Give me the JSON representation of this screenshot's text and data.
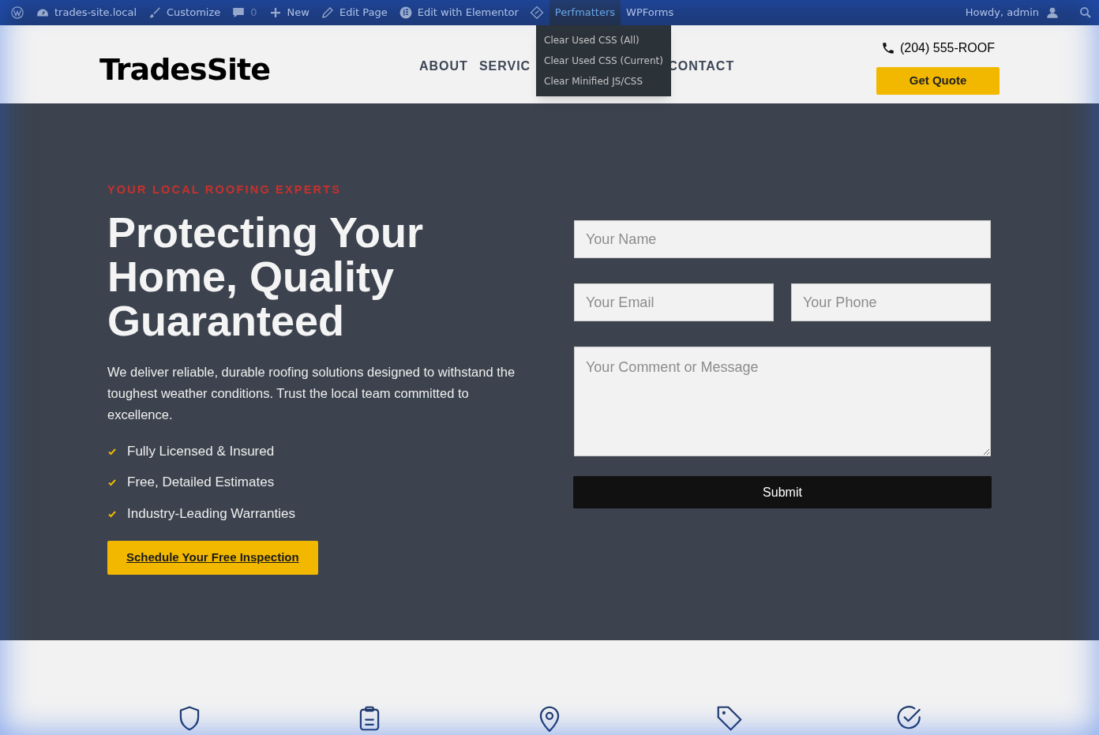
{
  "admin_bar": {
    "items": [
      {
        "kind": "wp"
      },
      {
        "kind": "site",
        "label": "trades-site.local"
      },
      {
        "kind": "brush",
        "label": "Customize"
      },
      {
        "kind": "comment",
        "label": "0"
      },
      {
        "kind": "plus",
        "label": "New"
      },
      {
        "kind": "pencil",
        "label": "Edit Page"
      },
      {
        "kind": "elementor",
        "label": "Edit with Elementor"
      },
      {
        "kind": "diamond"
      },
      {
        "kind": "text",
        "label": "Perfmatters",
        "selected": true
      },
      {
        "kind": "text",
        "label": "WPForms",
        "selected": false
      }
    ],
    "greeting": "Howdy, admin",
    "dropdown": [
      "Clear Used CSS (All)",
      "Clear Used CSS (Current)",
      "Clear Minified JS/CSS"
    ]
  },
  "header": {
    "logo": "TradesSite",
    "nav": [
      "ABOUT",
      "SERVIC",
      "CONTACT"
    ],
    "phone": "(204) 555-ROOF",
    "cta": "Get Quote"
  },
  "hero": {
    "eyebrow": "YOUR LOCAL ROOFING EXPERTS",
    "title": "Protecting Your Home, Quality Guaranteed",
    "body": "We deliver reliable, durable roofing solutions designed to withstand the toughest weather conditions. Trust the local team committed to excellence.",
    "features": [
      "Fully Licensed & Insured",
      "Free, Detailed Estimates",
      "Industry-Leading Warranties"
    ],
    "button": "Schedule Your Free Inspection",
    "form": {
      "name": {
        "placeholder": "Your Name"
      },
      "email": {
        "placeholder": "Your Email"
      },
      "phone": {
        "placeholder": "Your Phone"
      },
      "message": {
        "placeholder": "Your Comment or Message"
      },
      "submit": "Submit"
    }
  },
  "features_strip": [
    {
      "kind": "shield"
    },
    {
      "kind": "clipboard"
    },
    {
      "kind": "pin"
    },
    {
      "kind": "tag"
    },
    {
      "kind": "check"
    }
  ]
}
